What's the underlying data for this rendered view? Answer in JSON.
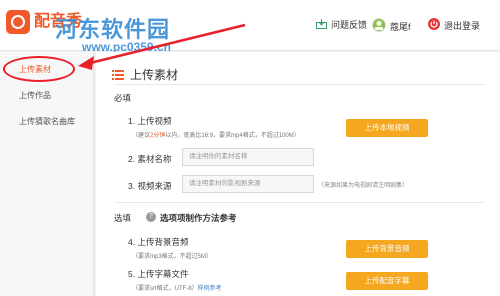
{
  "header": {
    "logo_text": "配音秀",
    "watermark_site": "河东软件园",
    "watermark_url": "www.pc0359.cn",
    "feedback_label": "问题反馈",
    "username": "蔻尾f",
    "logout_label": "退出登录"
  },
  "sidebar": {
    "items": [
      {
        "label": "上传素材"
      },
      {
        "label": "上传作品"
      },
      {
        "label": "上传猜歌名曲库"
      }
    ]
  },
  "main": {
    "title": "上传素材",
    "required_label": "必填",
    "optional_label": "选填",
    "optional_help_text": "选项项制作方法参考",
    "rows": {
      "video": {
        "label": "1. 上传视频",
        "hint_prefix": "（建议",
        "hint_highlight": "2分钟",
        "hint_suffix": "以内，宽高比16:9，要求mp4格式，不超过100M）",
        "button": "上传本地视频"
      },
      "name": {
        "label": "2. 素材名称",
        "placeholder": "请注明你的素材名称"
      },
      "source": {
        "label": "3. 视频来源",
        "placeholder": "请注明素材的影视剧来源",
        "note": "（来源如果为电视剧请注明剧集）"
      },
      "audio": {
        "label": "4. 上传背景音频",
        "hint": "（要求mp3格式，不超过5M）",
        "button": "上传背景音频"
      },
      "subtitle": {
        "label": "5. 上传字幕文件",
        "hint_prefix": "（要求srt格式，UTF-8）",
        "hint_link": "样例参考",
        "button": "上传配音字幕"
      }
    }
  },
  "colors": {
    "accent": "#f25a2a",
    "button": "#f5a71f",
    "annotation": "#e8202a",
    "watermark": "#3b8fd6"
  },
  "icons": [
    "logo-icon",
    "feedback-icon",
    "avatar-icon",
    "power-icon",
    "list-icon",
    "help-icon"
  ]
}
